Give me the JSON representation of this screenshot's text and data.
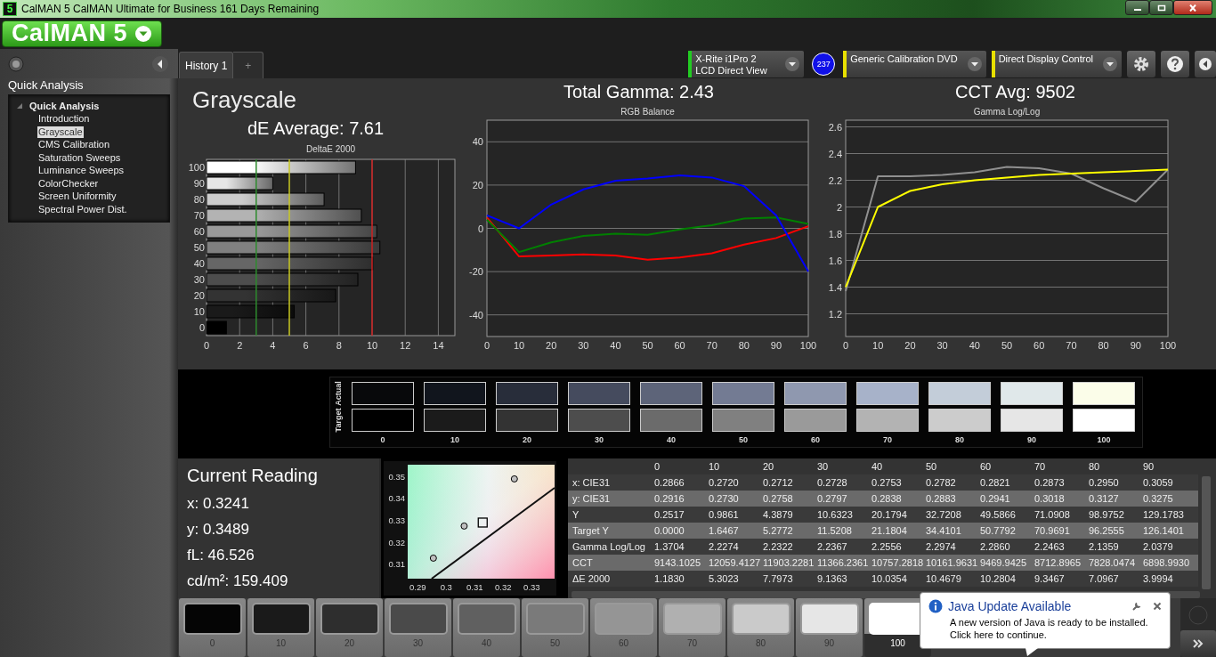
{
  "window": {
    "icon_text": "5",
    "title": "CalMAN 5 CalMAN Ultimate for Business 161 Days Remaining"
  },
  "logo": {
    "text": "CalMAN 5"
  },
  "tabs": [
    {
      "label": "History 1",
      "selected": true
    },
    {
      "label": "+",
      "selected": false
    }
  ],
  "devices": [
    {
      "lines": [
        "X-Rite i1Pro 2",
        "LCD Direct View"
      ],
      "color": "#22cc22",
      "badge": "237"
    },
    {
      "lines": [
        "Generic Calibration DVD"
      ],
      "color": "#e8e000"
    },
    {
      "lines": [
        "Direct Display Control"
      ],
      "color": "#e8e000"
    }
  ],
  "sidebar": {
    "title": "Quick Analysis",
    "tree": [
      {
        "label": "Quick Analysis",
        "expanded": true,
        "selected": false,
        "children": [
          {
            "label": "Introduction",
            "selected": false
          },
          {
            "label": "Grayscale",
            "selected": true
          },
          {
            "label": "CMS Calibration",
            "selected": false
          },
          {
            "label": "Saturation Sweeps",
            "selected": false
          },
          {
            "label": "Luminance Sweeps",
            "selected": false
          },
          {
            "label": "ColorChecker",
            "selected": false
          },
          {
            "label": "Screen Uniformity",
            "selected": false
          },
          {
            "label": "Spectral Power Dist.",
            "selected": false
          }
        ]
      }
    ]
  },
  "summary": {
    "title": "Grayscale",
    "de_average": "dE Average: 7.61",
    "total_gamma": "Total Gamma: 2.43",
    "cct_avg": "CCT Avg: 9502"
  },
  "delta_e_panel": {
    "chart_data": {
      "type": "bar",
      "orientation": "horizontal",
      "title": "DeltaE 2000",
      "categories": [
        "100",
        "90",
        "80",
        "70",
        "60",
        "50",
        "40",
        "30",
        "20",
        "10",
        "0"
      ],
      "values": [
        9.0,
        4.0,
        7.1,
        9.35,
        10.28,
        10.47,
        10.04,
        9.14,
        7.8,
        5.3,
        1.2
      ],
      "xlim": [
        0,
        15
      ],
      "xticks": [
        0,
        2,
        4,
        6,
        8,
        10,
        12,
        14
      ],
      "grid": true,
      "ref_lines": [
        {
          "axis": "x",
          "value": 3,
          "color": "#2e8b2e"
        },
        {
          "axis": "x",
          "value": 5,
          "color": "#c8c820"
        },
        {
          "axis": "x",
          "value": 10,
          "color": "#cc2020"
        }
      ]
    }
  },
  "rgb_panel": {
    "chart_data": {
      "type": "line",
      "title": "RGB Balance",
      "x": [
        0,
        10,
        20,
        30,
        40,
        50,
        60,
        70,
        80,
        90,
        100
      ],
      "xlim": [
        0,
        100
      ],
      "ylim": [
        -50,
        50
      ],
      "xticks": [
        0,
        10,
        20,
        30,
        40,
        50,
        60,
        70,
        80,
        90,
        100
      ],
      "yticks": [
        -40,
        -20,
        0,
        20,
        40
      ],
      "grid": true,
      "series": [
        {
          "color": "#ff0000",
          "values": [
            5,
            -13,
            -12.5,
            -12,
            -12.5,
            -14.5,
            -13.5,
            -11.5,
            -7.5,
            -4.5,
            1
          ]
        },
        {
          "color": "#008000",
          "values": [
            4,
            -11,
            -6.5,
            -3.5,
            -2.5,
            -3,
            -0.5,
            1.5,
            4.5,
            5,
            2
          ]
        },
        {
          "color": "#0000ff",
          "values": [
            6,
            0,
            11,
            18,
            22,
            23,
            24.5,
            23.5,
            19.5,
            6,
            -20
          ]
        }
      ]
    }
  },
  "gamma_panel": {
    "chart_data": {
      "type": "line",
      "title": "Gamma Log/Log",
      "x": [
        0,
        10,
        20,
        30,
        40,
        50,
        60,
        70,
        80,
        90,
        100
      ],
      "xlim": [
        0,
        100
      ],
      "ylim": [
        1.03,
        2.65
      ],
      "xticks": [
        0,
        10,
        20,
        30,
        40,
        50,
        60,
        70,
        80,
        90,
        100
      ],
      "yticks": [
        1.2,
        1.4,
        1.6,
        1.8,
        2,
        2.2,
        2.4,
        2.6
      ],
      "grid": true,
      "series": [
        {
          "color": "#909090",
          "values": [
            1.37,
            2.23,
            2.23,
            2.24,
            2.26,
            2.3,
            2.29,
            2.25,
            2.14,
            2.04,
            2.28
          ]
        },
        {
          "color": "#ffff00",
          "values": [
            1.4,
            2.0,
            2.12,
            2.17,
            2.2,
            2.22,
            2.24,
            2.25,
            2.26,
            2.27,
            2.28
          ]
        }
      ]
    }
  },
  "swatches": {
    "rows": [
      {
        "label": "Actual",
        "cells": [
          {
            "color": "#08090b"
          },
          {
            "color": "#11151d"
          },
          {
            "color": "#282d3a"
          },
          {
            "color": "#454b5e"
          },
          {
            "color": "#5d6479"
          },
          {
            "color": "#737b93"
          },
          {
            "color": "#8f98af"
          },
          {
            "color": "#a7b2c9"
          },
          {
            "color": "#c3cdd9"
          },
          {
            "color": "#e0e8ea"
          },
          {
            "color": "#fbfde9"
          }
        ]
      },
      {
        "label": "Target",
        "cells": [
          {
            "color": "#000000"
          },
          {
            "color": "#1b1b1b"
          },
          {
            "color": "#333333"
          },
          {
            "color": "#4d4d4d"
          },
          {
            "color": "#6b6b6b"
          },
          {
            "color": "#808080"
          },
          {
            "color": "#9a9a9a"
          },
          {
            "color": "#b3b3b3"
          },
          {
            "color": "#cccccc"
          },
          {
            "color": "#e6e6e6"
          },
          {
            "color": "#ffffff"
          }
        ]
      }
    ],
    "column_labels": [
      "0",
      "10",
      "20",
      "30",
      "40",
      "50",
      "60",
      "70",
      "80",
      "90",
      "100"
    ]
  },
  "current_reading": {
    "title": "Current Reading",
    "lines": [
      "x: 0.3241",
      "y: 0.3489",
      "fL: 46.526",
      "cd/m²: 159.409"
    ]
  },
  "cie_panel": {
    "chart_data": {
      "type": "scatter",
      "x": [
        0.2949,
        0.2955,
        0.3063,
        0.3128,
        0.3239,
        0.338
      ],
      "xlim": [
        0.2865,
        0.338
      ],
      "ylim": [
        0.3035,
        0.3557
      ],
      "xticks": [
        0.29,
        0.3,
        0.31,
        0.32,
        0.33
      ],
      "yticks": [
        0.31,
        0.32,
        0.33,
        0.34,
        0.35
      ],
      "series": [
        {
          "color": "#c0c0c0",
          "values": [
            null,
            0.3129,
            0.3276,
            null,
            0.3492,
            null
          ]
        },
        {
          "color": "#000000",
          "values": [
            null,
            null,
            null,
            0.3292,
            null,
            null
          ]
        },
        {
          "type": "line",
          "color": "#111111",
          "values": [
            0.3035,
            null,
            null,
            null,
            null,
            0.3451
          ]
        }
      ]
    }
  },
  "table": {
    "columns": [
      "0",
      "10",
      "20",
      "30",
      "40",
      "50",
      "60",
      "70",
      "80",
      "90"
    ],
    "rows": [
      {
        "label": "x: CIE31",
        "cells": [
          "0.2866",
          "0.2720",
          "0.2712",
          "0.2728",
          "0.2753",
          "0.2782",
          "0.2821",
          "0.2873",
          "0.2950",
          "0.3059"
        ]
      },
      {
        "label": "y: CIE31",
        "cells": [
          "0.2916",
          "0.2730",
          "0.2758",
          "0.2797",
          "0.2838",
          "0.2883",
          "0.2941",
          "0.3018",
          "0.3127",
          "0.3275"
        ]
      },
      {
        "label": "Y",
        "cells": [
          "0.2517",
          "0.9861",
          "4.3879",
          "10.6323",
          "20.1794",
          "32.7208",
          "49.5866",
          "71.0908",
          "98.9752",
          "129.1783"
        ]
      },
      {
        "label": "Target Y",
        "cells": [
          "0.0000",
          "1.6467",
          "5.2772",
          "11.5208",
          "21.1804",
          "34.4101",
          "50.7792",
          "70.9691",
          "96.2555",
          "126.1401"
        ]
      },
      {
        "label": "Gamma Log/Log",
        "cells": [
          "1.3704",
          "2.2274",
          "2.2322",
          "2.2367",
          "2.2556",
          "2.2974",
          "2.2860",
          "2.2463",
          "2.1359",
          "2.0379"
        ]
      },
      {
        "label": "CCT",
        "cells": [
          "9143.1025",
          "12059.4127",
          "11903.2281",
          "11366.2361",
          "10757.2818",
          "10161.9631",
          "9469.9425",
          "8712.8965",
          "7828.0474",
          "6898.9930"
        ]
      },
      {
        "label": "ΔE 2000",
        "cells": [
          "1.1830",
          "5.3023",
          "7.7973",
          "9.1363",
          "10.0354",
          "10.4679",
          "10.2804",
          "9.3467",
          "7.0967",
          "3.9994"
        ]
      }
    ]
  },
  "patches": [
    {
      "label": "0",
      "color": "#050505",
      "selected": false
    },
    {
      "label": "10",
      "color": "#1a1a1a",
      "selected": false
    },
    {
      "label": "20",
      "color": "#2e2e2e",
      "selected": false
    },
    {
      "label": "30",
      "color": "#4a4a4a",
      "selected": false
    },
    {
      "label": "40",
      "color": "#606060",
      "selected": false
    },
    {
      "label": "50",
      "color": "#7a7a7a",
      "selected": false
    },
    {
      "label": "60",
      "color": "#959595",
      "selected": false
    },
    {
      "label": "70",
      "color": "#b0b0b0",
      "selected": false
    },
    {
      "label": "80",
      "color": "#cacaca",
      "selected": false
    },
    {
      "label": "90",
      "color": "#e6e6e6",
      "selected": false
    },
    {
      "label": "100",
      "color": "#ffffff",
      "selected": true
    }
  ],
  "notification": {
    "title": "Java Update Available",
    "lines": [
      "A new version of Java is ready to be installed.",
      "Click here to continue."
    ]
  }
}
